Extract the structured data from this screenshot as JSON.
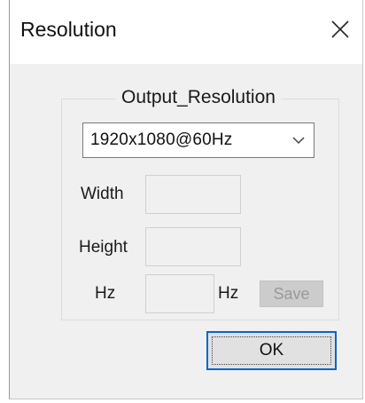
{
  "window": {
    "title": "Resolution",
    "close_icon": "close-icon"
  },
  "group": {
    "legend": "Output_Resolution",
    "resolution_select": {
      "value": "1920x1080@60Hz",
      "arrow_icon": "chevron-down-icon"
    },
    "fields": {
      "width_label": "Width",
      "width_value": "",
      "height_label": "Height",
      "height_value": "",
      "hz_label": "Hz",
      "hz_value": "",
      "hz_suffix": "Hz"
    },
    "save_label": "Save"
  },
  "ok_label": "OK",
  "colors": {
    "focus_border": "#0a64c8",
    "dialog_bg": "#f0f0f0"
  }
}
